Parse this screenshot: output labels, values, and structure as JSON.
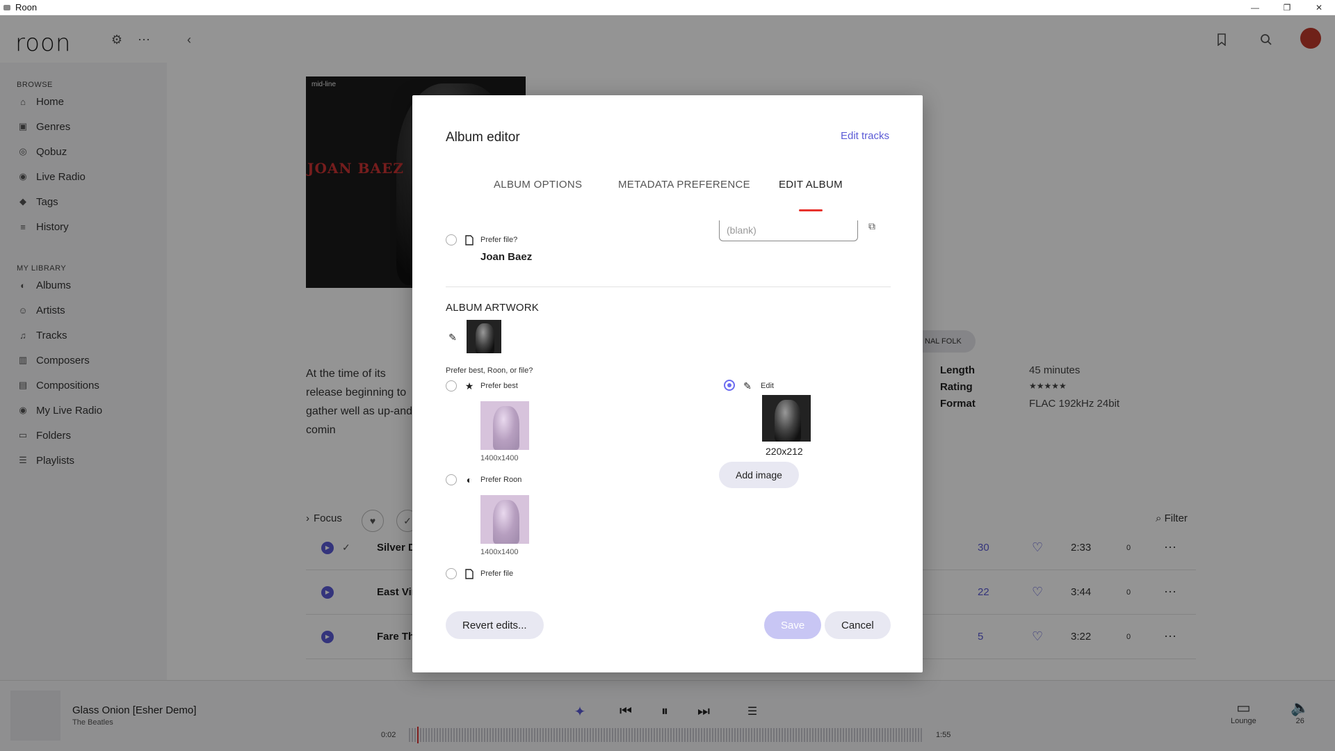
{
  "window": {
    "title": "Roon",
    "minimize": "—",
    "maximize": "❐",
    "close": "✕"
  },
  "topbar": {
    "logo": "roon"
  },
  "sidebar": {
    "browse_heading": "BROWSE",
    "browse_items": [
      {
        "label": "Home",
        "icon": "home-icon"
      },
      {
        "label": "Genres",
        "icon": "genres-icon"
      },
      {
        "label": "Qobuz",
        "icon": "qobuz-icon"
      },
      {
        "label": "Live Radio",
        "icon": "radio-icon"
      },
      {
        "label": "Tags",
        "icon": "tag-icon"
      },
      {
        "label": "History",
        "icon": "history-icon"
      }
    ],
    "library_heading": "MY LIBRARY",
    "library_items": [
      {
        "label": "Albums",
        "icon": "albums-icon"
      },
      {
        "label": "Artists",
        "icon": "artists-icon"
      },
      {
        "label": "Tracks",
        "icon": "tracks-icon"
      },
      {
        "label": "Composers",
        "icon": "composers-icon"
      },
      {
        "label": "Compositions",
        "icon": "compositions-icon"
      },
      {
        "label": "My Live Radio",
        "icon": "radio-icon"
      },
      {
        "label": "Folders",
        "icon": "folder-icon"
      },
      {
        "label": "Playlists",
        "icon": "playlist-icon"
      }
    ]
  },
  "album": {
    "cover_name": "JOAN BAEZ",
    "cover_badge": "mid-line",
    "description": "At the time of its release beginning to gather well as up-and-comin",
    "genre_chip": "NAL FOLK",
    "meta": [
      {
        "key": "Length",
        "value": "45 minutes"
      },
      {
        "key": "Rating",
        "value": "★★★★★"
      },
      {
        "key": "Format",
        "value": "FLAC 192kHz 24bit"
      }
    ]
  },
  "track_list": {
    "focus_label": "Focus",
    "filter_label": "Filter",
    "tracks": [
      {
        "name": "Silver D",
        "plays": "30",
        "duration": "2:33",
        "count": "0"
      },
      {
        "name": "East Vir",
        "plays": "22",
        "duration": "3:44",
        "count": "0"
      },
      {
        "name": "Fare The",
        "plays": "5",
        "duration": "3:22",
        "count": "0"
      }
    ]
  },
  "now_playing": {
    "title": "Glass Onion [Esher Demo]",
    "artist": "The Beatles",
    "elapsed": "0:02",
    "total": "1:55",
    "zone": "Lounge",
    "volume": "26"
  },
  "modal": {
    "title": "Album editor",
    "edit_tracks": "Edit tracks",
    "tabs": [
      "ALBUM OPTIONS",
      "METADATA PREFERENCE",
      "EDIT ALBUM"
    ],
    "active_tab": "EDIT ALBUM",
    "artist_field": {
      "prefer_file_label": "Prefer file?",
      "value": "Joan Baez",
      "placeholder": "(blank)"
    },
    "artwork": {
      "heading": "ALBUM ARTWORK",
      "question": "Prefer best, Roon, or file?",
      "prefer_best": "Prefer best",
      "prefer_best_size": "1400x1400",
      "prefer_roon": "Prefer Roon",
      "prefer_roon_size": "1400x1400",
      "prefer_file": "Prefer file",
      "edit_label": "Edit",
      "edit_size": "220x212",
      "add_image": "Add image"
    },
    "buttons": {
      "revert": "Revert edits...",
      "save": "Save",
      "cancel": "Cancel"
    }
  },
  "colors": {
    "accent": "#5b5bd6",
    "tab_underline": "#e8322c",
    "radio_on": "#6b6bf0"
  }
}
